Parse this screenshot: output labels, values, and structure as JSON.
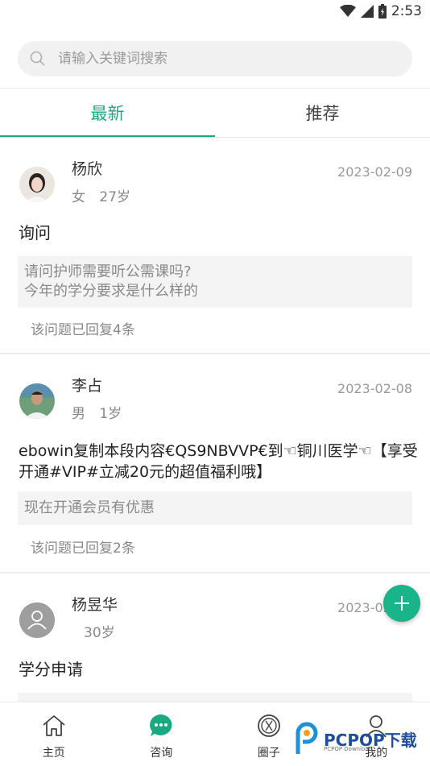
{
  "status_bar": {
    "time": "2:53"
  },
  "search": {
    "placeholder": "请输入关键词搜索"
  },
  "tabs": [
    {
      "label": "最新",
      "active": true
    },
    {
      "label": "推荐",
      "active": false
    }
  ],
  "posts": [
    {
      "name": "杨欣",
      "gender": "女",
      "age": "27岁",
      "date": "2023-02-09",
      "title": "询问",
      "body": [
        "请问护师需要听公需课吗?",
        "今年的学分要求是什么样的"
      ],
      "reply": "该问题已回复4条"
    },
    {
      "name": "李占",
      "gender": "男",
      "age": "1岁",
      "date": "2023-02-08",
      "title_lines": [
        "ebowin复制本段内容€QS9NBVVP€到☜铜川医学☜【享受",
        "开通#VIP#立减20元的超值福利哦】"
      ],
      "body": [
        "现在开通会员有优惠"
      ],
      "reply": "该问题已回复2条"
    },
    {
      "name": "杨昱华",
      "gender": "",
      "age": "30岁",
      "date": "2023-02-08",
      "title": "学分申请"
    }
  ],
  "tabbar": [
    {
      "label": "主页",
      "icon": "home-icon"
    },
    {
      "label": "咨询",
      "icon": "chat-icon",
      "active": true
    },
    {
      "label": "圈子",
      "icon": "circle-icon"
    },
    {
      "label": "我的",
      "icon": "user-icon"
    }
  ],
  "watermark": {
    "text": "PCPOP下载",
    "sub": "PCPOP Download"
  },
  "colors": {
    "accent": "#1aa883",
    "fab": "#19b48a"
  }
}
